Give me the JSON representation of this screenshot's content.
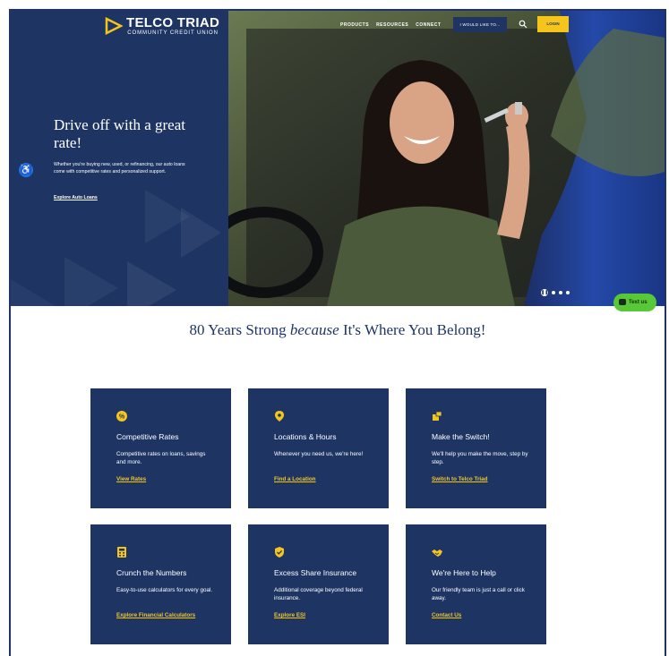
{
  "brand": {
    "name": "TELCO TRIAD",
    "subtitle": "COMMUNITY CREDIT UNION"
  },
  "nav": {
    "items": [
      "PRODUCTS",
      "RESOURCES",
      "CONNECT"
    ],
    "want_label": "I WOULD LIKE TO...",
    "login_label": "LOGIN"
  },
  "hero": {
    "title": "Drive off with a great rate!",
    "description": "Whether you're buying new, used, or refinancing, our auto loans come with competitive rates and personalized support.",
    "link": "Explore Auto Loans",
    "slide_count": 3,
    "current_slide": 1
  },
  "chat": {
    "label": "Text us"
  },
  "headline": {
    "before": "80 Years Strong ",
    "emphasis": "because",
    "after": " It's Where You Belong!"
  },
  "cards": [
    {
      "icon": "percent-icon",
      "title": "Competitive Rates",
      "description": "Competitive rates on loans, savings and more.",
      "link": "View Rates"
    },
    {
      "icon": "location-pin-icon",
      "title": "Locations & Hours",
      "description": "Whenever you need us, we're here!",
      "link": "Find a Location"
    },
    {
      "icon": "switch-boxes-icon",
      "title": "Make the Switch!",
      "description": "We'll help you make the move, step by step.",
      "link": "Switch to Telco Triad"
    },
    {
      "icon": "calculator-icon",
      "title": "Crunch the Numbers",
      "description": "Easy-to-use calculators for every goal.",
      "link": "Explore Financial Calculators"
    },
    {
      "icon": "shield-check-icon",
      "title": "Excess Share Insurance",
      "description": "Additional coverage beyond federal insurance.",
      "link": "Explore ESI"
    },
    {
      "icon": "handshake-icon",
      "title": "We're Here to Help",
      "description": "Our friendly team is just a call or click away.",
      "link": "Contact Us"
    }
  ],
  "colors": {
    "navy": "#1e3564",
    "gold": "#f5c51c",
    "chat_green": "#57c937",
    "accessibility_blue": "#1d74e8"
  }
}
